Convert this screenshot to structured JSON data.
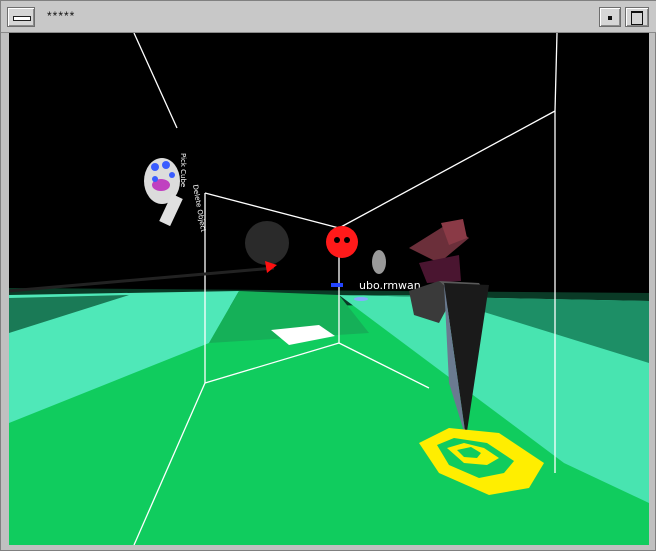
{
  "window": {
    "title": "*****",
    "menu_button_icon": "window-menu-icon",
    "minimize_icon": "minimize-icon",
    "maximize_icon": "maximize-icon"
  },
  "scene": {
    "floor_color": "#10d060",
    "wall_color": "#40e0b0",
    "sky_color": "#000000",
    "target_color": "#ffee00",
    "ball_color": "#ff1010",
    "labels": {
      "ball_label": "ubo.rmwan",
      "menu_label_1": "Pick Cube",
      "menu_label_2": "Delete Object"
    }
  }
}
